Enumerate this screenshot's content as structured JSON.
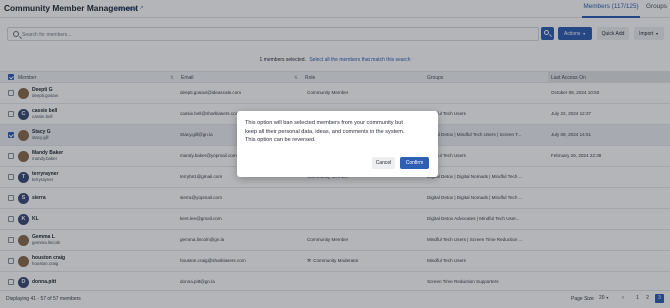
{
  "header": {
    "title": "Community Member Management",
    "learn_more": "Learn More",
    "tabs": {
      "members": "Members (117/125)",
      "groups": "Groups"
    }
  },
  "toolbar": {
    "search_placeholder": "Search for members...",
    "actions_label": "Actions",
    "quick_add_label": "Quick Add",
    "import_label": "Import"
  },
  "selection": {
    "count_text": "1 members selected.",
    "select_all_text": "Select all the members that match this search"
  },
  "table": {
    "columns": {
      "member": "Member",
      "email": "Email",
      "role": "Role",
      "groups": "Groups",
      "last_access": "Last Access On"
    },
    "rows": [
      {
        "name": "Deepti G",
        "username": "deepti.gosavi",
        "avatar": "photo",
        "checked": false,
        "email": "deepti.gosavi@ideascale.com",
        "role": "Community Member",
        "groups": "",
        "last_access": "October 08, 2024 10:50"
      },
      {
        "name": "cassie bell",
        "username": "cassie.bell",
        "avatar": "C",
        "checked": false,
        "email": "cassie.bell@sharklasers.com",
        "role": "",
        "groups": "Mindful Tech Users",
        "last_access": "July 22, 2024 12:37"
      },
      {
        "name": "Stacy G",
        "username": "stacy.gill",
        "avatar": "photo",
        "checked": true,
        "email": "Stacy.gill@gn.la",
        "role": "",
        "groups": "Digital Detox | Mindful Tech Users | Screen T...",
        "last_access": "July 09, 2024 14:51"
      },
      {
        "name": "Mandy Baker",
        "username": "mandy.baker",
        "avatar": "photo",
        "checked": false,
        "email": "mandy.baker@yopmail.com",
        "role": "",
        "groups": "Mindful Tech Users",
        "last_access": "February 26, 2024 22:38"
      },
      {
        "name": "terryrayner",
        "username": "terryrayner",
        "avatar": "T",
        "checked": false,
        "email": "terrybs1@gmail.com",
        "role": "Community Member",
        "groups": "Digital Detox | Digital Nomads | Mindful Tech ...",
        "last_access": ""
      },
      {
        "name": "sierra",
        "username": "",
        "avatar": "S",
        "checked": false,
        "email": "sierra@yopmail.com",
        "role": "",
        "groups": "Digital Detox | Digital Nomads | Mindful Tech ...",
        "last_access": ""
      },
      {
        "name": "KL",
        "username": "",
        "avatar": "K",
        "checked": false,
        "email": "kent.lee@gmail.com",
        "role": "",
        "groups": "Digital Detox Advocates | Mindful Tech User...",
        "last_access": ""
      },
      {
        "name": "Gemma L",
        "username": "gemma.lincoln",
        "avatar": "photo",
        "checked": false,
        "email": "gemma.lincoln@gn.la",
        "role": "Community Member",
        "groups": "Mindful Tech Users | Screen Time Reduction ...",
        "last_access": ""
      },
      {
        "name": "houston craig",
        "username": "houston.craig",
        "avatar": "photo",
        "checked": false,
        "email": "houston.craig@sharklasers.com",
        "role": "Community Moderator",
        "groups": "Mindful Tech Users",
        "last_access": ""
      },
      {
        "name": "donna.pitt",
        "username": "",
        "avatar": "D",
        "checked": false,
        "email": "donna.pitt@gn.la",
        "role": "",
        "groups": "Screen Time Reduction Supporters",
        "last_access": ""
      }
    ]
  },
  "footer": {
    "displaying": "Displaying 41 - 57 of 57 members",
    "page_size_label": "Page Size",
    "page_size_value": "20",
    "pages": [
      "1",
      "2",
      "3"
    ],
    "active_page": "3"
  },
  "modal": {
    "lines": [
      "This option will ban selected members from your community but",
      "keep all their personal data, ideas, and comments in the system.",
      "This option can be reversed."
    ],
    "cancel_label": "Cancel",
    "confirm_label": "Confirm"
  },
  "colors": {
    "accent": "#2f5fb3",
    "overlay": "rgba(20,24,33,0.32)"
  }
}
